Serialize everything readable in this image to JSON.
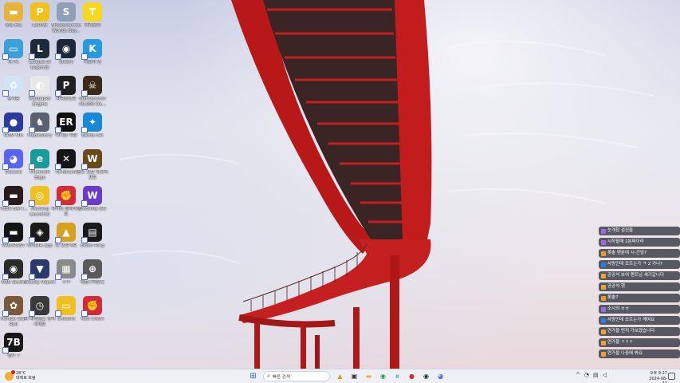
{
  "desktop": {
    "icons": [
      {
        "label": "ella ma",
        "icon": "folder-icon",
        "color": "#e8b33a",
        "glyph": "▬"
      },
      {
        "label": "CoPilot",
        "icon": "copilot-icon",
        "color": "#f2c21b",
        "glyph": "P"
      },
      {
        "label": "Shadowverse Worlds Bey...",
        "icon": "shadowverse-icon",
        "color": "#8fa0b8",
        "glyph": "S"
      },
      {
        "label": "카카오톡",
        "icon": "kakaotalk-icon",
        "color": "#f7d81c",
        "glyph": "T"
      },
      {
        "label": "내 PC",
        "icon": "monitor-icon",
        "color": "#3aa0d8",
        "glyph": "▭"
      },
      {
        "label": "League of Legends",
        "icon": "league-icon",
        "color": "#1c2a3a",
        "glyph": "L"
      },
      {
        "label": "Steam",
        "icon": "steam-icon",
        "color": "#1b2838",
        "glyph": "◉"
      },
      {
        "label": "다모아 인",
        "icon": "k-app-icon",
        "color": "#2a9ae0",
        "glyph": "K"
      },
      {
        "label": "휴지통",
        "icon": "recycle-bin-icon",
        "color": "#d0e4f4",
        "glyph": "♻"
      },
      {
        "label": "Wallpaper Engine",
        "icon": "wallpaper-engine-icon",
        "color": "#e8e8e8",
        "glyph": "◐"
      },
      {
        "label": "파워포인트",
        "icon": "p-app-icon",
        "color": "#202020",
        "glyph": "P"
      },
      {
        "label": "Warhammer 40,000 Da...",
        "icon": "warhammer-icon",
        "color": "#3a2a1a",
        "glyph": "☠"
      },
      {
        "label": "GOM Mix",
        "icon": "dots-app-icon",
        "color": "#2c3c9c",
        "glyph": "●"
      },
      {
        "label": "MapleStory",
        "icon": "maple-icon",
        "color": "#5a6070",
        "glyph": "♞"
      },
      {
        "label": "이터널 리턴",
        "icon": "eternal-return-icon",
        "color": "#101010",
        "glyph": "ER"
      },
      {
        "label": "Battle.net",
        "icon": "battlenet-icon",
        "color": "#1a88d8",
        "glyph": "✦"
      },
      {
        "label": "Discord",
        "icon": "discord-icon",
        "color": "#5865f2",
        "glyph": "◕"
      },
      {
        "label": "Microsoft Edge",
        "icon": "edge-icon",
        "color": "#1a9a9a",
        "glyph": "e"
      },
      {
        "label": "TikTokLive",
        "icon": "x-app-icon",
        "color": "#151515",
        "glyph": "✕"
      },
      {
        "label": "월드 오브 워크래프트",
        "icon": "wow-icon",
        "color": "#6a4a1a",
        "glyph": "W"
      },
      {
        "label": "PUBG BATT...",
        "icon": "pubg-icon",
        "color": "#2a1a1a",
        "glyph": "▬"
      },
      {
        "label": "Wooting Launcher",
        "icon": "wooting-icon",
        "color": "#f0c020",
        "glyph": "◎"
      },
      {
        "label": "라이엇 클라이언트",
        "icon": "riot-icon",
        "color": "#d42a3a",
        "glyph": "✊"
      },
      {
        "label": "Wootility-GG",
        "icon": "w-app-icon",
        "color": "#6a3ac8",
        "glyph": "W"
      },
      {
        "label": "VALORANT",
        "icon": "valorant-icon",
        "color": "#151515",
        "glyph": "▬"
      },
      {
        "label": "NVIDIA App",
        "icon": "nvidia-icon",
        "color": "#1a1a1a",
        "glyph": "◈"
      },
      {
        "label": "칸 프로젝트",
        "icon": "k-project-icon",
        "color": "#d8a020",
        "glyph": "▲"
      },
      {
        "label": "Elden Ring",
        "icon": "elden-icon",
        "color": "#1a1a1a",
        "glyph": "▤"
      },
      {
        "label": "OBS Studio",
        "icon": "obs-icon",
        "color": "#2a2a2a",
        "glyph": "◉"
      },
      {
        "label": "Weekly Report",
        "icon": "triangle-app-icon",
        "color": "#2a3a6a",
        "glyph": "▼"
      },
      {
        "label": "ㄹ'P",
        "icon": "image-file-icon",
        "color": "#8a8a8a",
        "glyph": "▦"
      },
      {
        "label": "배틀그라운드",
        "icon": "battleground-icon",
        "color": "#5a5a5a",
        "glyph": "⊕"
      },
      {
        "label": "Honkai Star Rail",
        "icon": "honkai-icon",
        "color": "#7a5a3a",
        "glyph": "✿"
      },
      {
        "label": "더 파이널스 전적 사이트",
        "icon": "clock-app-icon",
        "color": "#3a3a3a",
        "glyph": "◷"
      },
      {
        "label": "Uniwork",
        "icon": "chat-app-icon",
        "color": "#f0c020",
        "glyph": "▭"
      },
      {
        "label": "Riot Client",
        "icon": "riot-client-icon",
        "color": "#d42a3a",
        "glyph": "✊"
      },
      {
        "label": "텐구 7",
        "icon": "seventy-eight-icon",
        "color": "#181818",
        "glyph": "7B"
      }
    ]
  },
  "chat": {
    "messages": [
      {
        "name": "",
        "text": "눈개청 검진들",
        "badge_color": "#9a6ae8"
      },
      {
        "name": "",
        "text": "시작할때 2분짜이라",
        "badge_color": "#9a6ae8"
      },
      {
        "name": "",
        "text": "롯솔 랜문에 시-간임?",
        "badge_color": "#e89a2a"
      },
      {
        "name": "",
        "text": "사랑인데 모르는가 ㅋ 2 가나?",
        "badge_color": "#2a7ae8"
      },
      {
        "name": "",
        "text": "공공석 보여 랜트님 세기갑니다",
        "badge_color": "#e8a23a"
      },
      {
        "name": "",
        "text": "공공석 햇",
        "badge_color": "#e8a23a"
      },
      {
        "name": "",
        "text": "롯솔7",
        "badge_color": "#e89a2a"
      },
      {
        "name": "",
        "text": "소시의 ㅂㅂ",
        "badge_color": "#9a6ae8"
      },
      {
        "name": "",
        "text": "사랑인데 모르는가 께여요",
        "badge_color": "#2a7ae8"
      },
      {
        "name": "",
        "text": "연가을 먼저 가보겠습니다",
        "badge_color": "#e8a23a"
      },
      {
        "name": "",
        "text": "연가을 ㅈㅈㅈ",
        "badge_color": "#e8a23a"
      },
      {
        "name": "",
        "text": "연가을 나중에 봐요",
        "badge_color": "#e8a23a"
      }
    ]
  },
  "taskbar": {
    "weather_temp": "28°C",
    "weather_desc": "대체로 흐림",
    "search_placeholder": "빠른 검색",
    "clock_time": "오후 9:27",
    "clock_date": "2024-08-31",
    "apps": [
      {
        "icon": "start-icon",
        "glyph": "⊞",
        "color": "#1a6ae0"
      },
      {
        "icon": "search-icon",
        "glyph": "⌕",
        "color": "#333333"
      },
      {
        "icon": "paint-icon",
        "glyph": "▲",
        "color": "#d8a020"
      },
      {
        "icon": "task-view-icon",
        "glyph": "▣",
        "color": "#333333"
      },
      {
        "icon": "file-explorer-icon",
        "glyph": "▬",
        "color": "#e8b33a"
      },
      {
        "icon": "chrome-icon",
        "glyph": "◉",
        "color": "#2a9a4a"
      },
      {
        "icon": "edge-icon",
        "glyph": "e",
        "color": "#1a9a9a"
      },
      {
        "icon": "game-launcher-icon",
        "glyph": "●",
        "color": "#d42a3a"
      },
      {
        "icon": "steam-icon",
        "glyph": "◉",
        "color": "#1b2838"
      },
      {
        "icon": "discord-icon",
        "glyph": "◕",
        "color": "#5865f2"
      }
    ],
    "tray": [
      {
        "icon": "chevron-up-icon",
        "glyph": "^"
      },
      {
        "icon": "chat-bubble-icon",
        "glyph": "◔"
      },
      {
        "icon": "network-icon",
        "glyph": "▤"
      },
      {
        "icon": "volume-icon",
        "glyph": "◁"
      }
    ]
  }
}
